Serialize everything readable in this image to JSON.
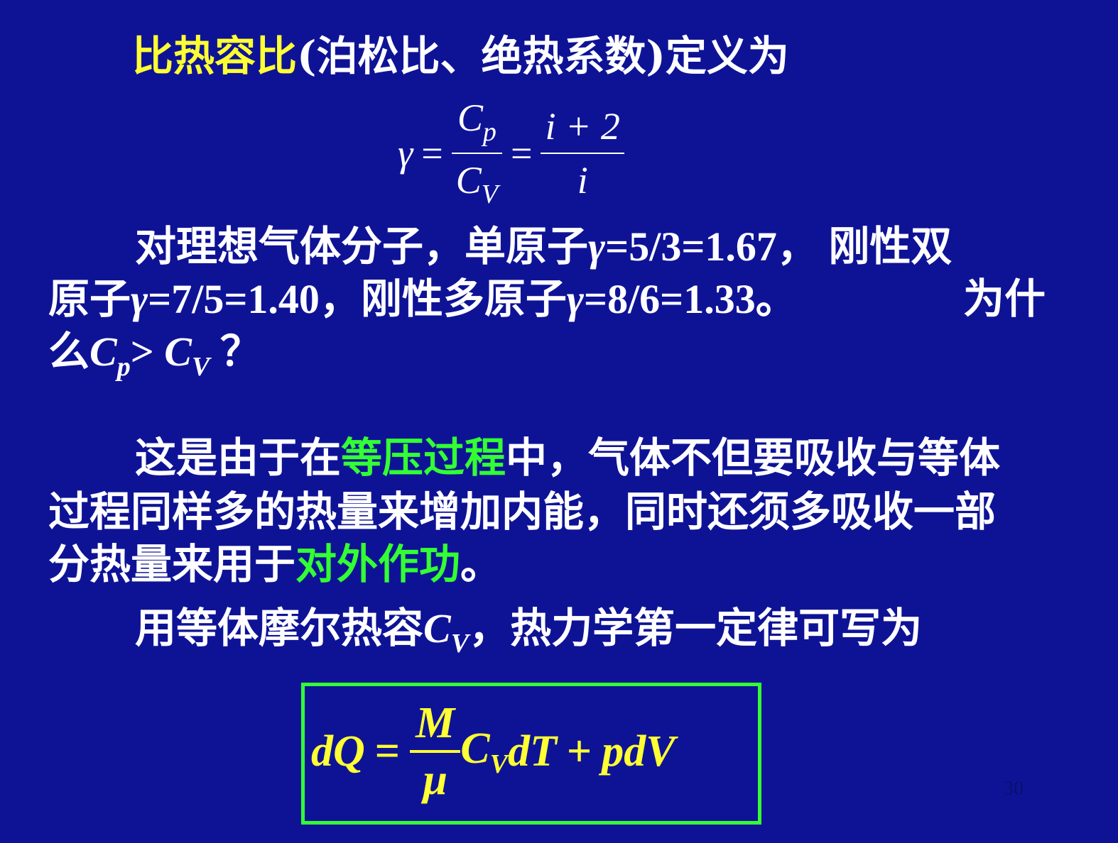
{
  "colors": {
    "background": "#0e1396",
    "text": "#ffffff",
    "highlight_yellow": "#ffff33",
    "highlight_green": "#33ff33"
  },
  "title": {
    "term": "比热容比",
    "rest": "(泊松比、绝热系数)定义为"
  },
  "gamma_formula": {
    "lhs": "γ",
    "eq1": "=",
    "frac1_num": "C",
    "frac1_num_sub": "p",
    "frac1_den": "C",
    "frac1_den_sub": "V",
    "eq2": "=",
    "frac2_num": "i + 2",
    "frac2_den": "i"
  },
  "para1": {
    "line1_a": "对理想气体分子，单原子",
    "line1_gamma": "γ",
    "line1_b": "=5/3=1.67，  刚性双",
    "line2_a": "原子",
    "line2_gamma1": "γ",
    "line2_b": "=7/5=1.40，刚性多原子",
    "line2_gamma2": "γ",
    "line2_c": "=8/6=1.33。",
    "line2_d": "为什",
    "line3_a": "么",
    "line3_cp": "C",
    "line3_cp_sub": "p",
    "line3_gt": "> ",
    "line3_cv": "C",
    "line3_cv_sub": "V",
    "line3_q": " ？"
  },
  "para2": {
    "line1_a": "这是由于在",
    "line1_green": "等压过程",
    "line1_b": "中，气体不但要吸收与等体",
    "line2": "过程同样多的热量来增加内能，同时还须多吸收一部",
    "line3_a": "分热量来用于",
    "line3_green": "对外作功",
    "line3_b": "。"
  },
  "para3": {
    "text_a": "用等体摩尔热容",
    "cv": "C",
    "cv_sub": "V",
    "text_b": "，热力学第一定律可写为"
  },
  "boxed_formula": {
    "lhs": "dQ",
    "eq": "=",
    "frac_num": "M",
    "frac_den": "μ",
    "cv": "C",
    "cv_sub": "V",
    "dt": "dT",
    "plus": "+",
    "pdv": "pdV"
  },
  "page_number": "30"
}
